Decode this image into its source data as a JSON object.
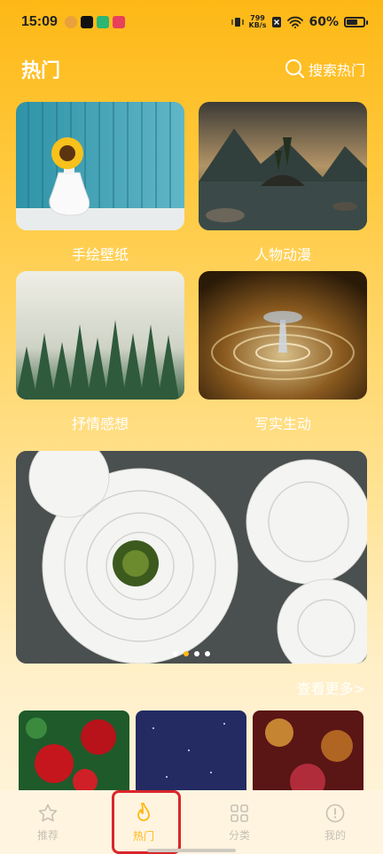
{
  "status_bar": {
    "time": "15:09",
    "net_speed_value": "799",
    "net_speed_unit": "KB/s",
    "battery_percent": "60%",
    "battery_level": 0.6
  },
  "header": {
    "title": "热门",
    "search_label": "搜索热门"
  },
  "categories": [
    {
      "label": "手绘壁纸"
    },
    {
      "label": "人物动漫"
    },
    {
      "label": "抒情感想"
    },
    {
      "label": "写实生动"
    }
  ],
  "banner": {
    "dots_total": 4,
    "active_dot": 1
  },
  "see_more": "查看更多>",
  "bottom_nav": [
    {
      "label": "推荐",
      "icon": "star-icon"
    },
    {
      "label": "热门",
      "icon": "flame-icon"
    },
    {
      "label": "分类",
      "icon": "grid-icon"
    },
    {
      "label": "我的",
      "icon": "profile-icon"
    }
  ],
  "colors": {
    "accent": "#FDB816",
    "highlight": "#D9262B"
  }
}
